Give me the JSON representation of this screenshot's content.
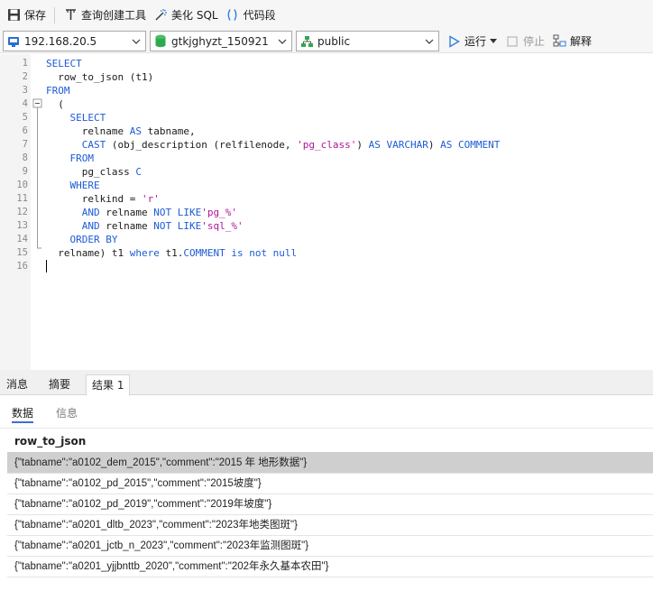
{
  "toolbar": {
    "save_label": "保存",
    "query_builder_label": "查询创建工具",
    "beautify_label": "美化 SQL",
    "snippet_label": "代码段",
    "run_label": "运行",
    "stop_label": "停止",
    "explain_label": "解释"
  },
  "connection": {
    "host": "192.168.20.5",
    "database": "gtkjghyzt_150921",
    "schema": "public"
  },
  "editor": {
    "line_numbers": [
      "1",
      "2",
      "3",
      "4",
      "5",
      "6",
      "7",
      "8",
      "9",
      "10",
      "11",
      "12",
      "13",
      "14",
      "15",
      "16"
    ],
    "lines": [
      [
        {
          "t": "SELECT",
          "c": "kw"
        }
      ],
      [
        {
          "t": "  row_to_json (t1)",
          "c": "id"
        }
      ],
      [
        {
          "t": "FROM",
          "c": "kw"
        }
      ],
      [
        {
          "t": "  (",
          "c": "id"
        }
      ],
      [
        {
          "t": "    ",
          "c": "id"
        },
        {
          "t": "SELECT",
          "c": "kw"
        }
      ],
      [
        {
          "t": "      relname ",
          "c": "id"
        },
        {
          "t": "AS",
          "c": "kw"
        },
        {
          "t": " tabname,",
          "c": "id"
        }
      ],
      [
        {
          "t": "      ",
          "c": "id"
        },
        {
          "t": "CAST",
          "c": "kw"
        },
        {
          "t": " (obj_description (relfilenode, ",
          "c": "id"
        },
        {
          "t": "'pg_class'",
          "c": "str"
        },
        {
          "t": ") ",
          "c": "id"
        },
        {
          "t": "AS VARCHAR",
          "c": "kw"
        },
        {
          "t": ") ",
          "c": "id"
        },
        {
          "t": "AS COMMENT",
          "c": "kw"
        }
      ],
      [
        {
          "t": "    ",
          "c": "id"
        },
        {
          "t": "FROM",
          "c": "kw"
        }
      ],
      [
        {
          "t": "      pg_class ",
          "c": "id"
        },
        {
          "t": "C",
          "c": "kw"
        }
      ],
      [
        {
          "t": "    ",
          "c": "id"
        },
        {
          "t": "WHERE",
          "c": "kw"
        }
      ],
      [
        {
          "t": "      relkind = ",
          "c": "id"
        },
        {
          "t": "'r'",
          "c": "str"
        }
      ],
      [
        {
          "t": "      ",
          "c": "id"
        },
        {
          "t": "AND",
          "c": "kw"
        },
        {
          "t": " relname ",
          "c": "id"
        },
        {
          "t": "NOT LIKE",
          "c": "kw"
        },
        {
          "t": "'pg_%'",
          "c": "str"
        }
      ],
      [
        {
          "t": "      ",
          "c": "id"
        },
        {
          "t": "AND",
          "c": "kw"
        },
        {
          "t": " relname ",
          "c": "id"
        },
        {
          "t": "NOT LIKE",
          "c": "kw"
        },
        {
          "t": "'sql_%'",
          "c": "str"
        }
      ],
      [
        {
          "t": "    ",
          "c": "id"
        },
        {
          "t": "ORDER BY",
          "c": "kw"
        }
      ],
      [
        {
          "t": "  relname) t1 ",
          "c": "id"
        },
        {
          "t": "where",
          "c": "kw"
        },
        {
          "t": " t1.",
          "c": "id"
        },
        {
          "t": "COMMENT",
          "c": "kw"
        },
        {
          "t": " ",
          "c": "id"
        },
        {
          "t": "is not null",
          "c": "kw"
        }
      ],
      []
    ]
  },
  "result_tabs": [
    "消息",
    "摘要",
    "结果 1"
  ],
  "sub_tabs": [
    "数据",
    "信息"
  ],
  "grid": {
    "column": "row_to_json",
    "rows": [
      "{\"tabname\":\"a0102_dem_2015\",\"comment\":\"2015 年 地形数据\"}",
      "{\"tabname\":\"a0102_pd_2015\",\"comment\":\"2015坡度\"}",
      "{\"tabname\":\"a0102_pd_2019\",\"comment\":\"2019年坡度\"}",
      "{\"tabname\":\"a0201_dltb_2023\",\"comment\":\"2023年地类图斑\"}",
      "{\"tabname\":\"a0201_jctb_n_2023\",\"comment\":\"2023年监测图斑\"}",
      "{\"tabname\":\"a0201_yjjbnttb_2020\",\"comment\":\"202年永久基本农田\"}"
    ]
  },
  "colors": {
    "keyword": "#1e5bd6",
    "string": "#b0149a",
    "selected_row": "#cfcfcf",
    "run_icon": "#2f7fe0",
    "db_icon": "#2fa84f"
  }
}
